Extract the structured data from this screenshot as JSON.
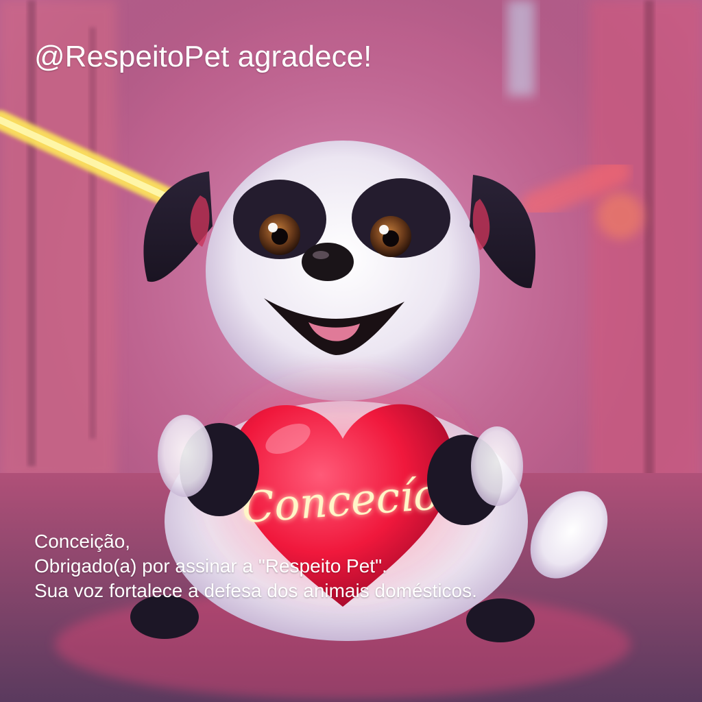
{
  "headline": "@RespeitoPet agradece!",
  "heart_text": "Concecío",
  "message": {
    "line1": "Conceição,",
    "line2": "Obrigado(a) por assinar a \"Respeito Pet\".",
    "line3": "Sua voz fortalece a defesa dos animais domésticos."
  },
  "colors": {
    "heart": "#f0183c",
    "neon_text": "#fff6c8",
    "neon_strip": "#ffe85a",
    "background": "#c0608a"
  }
}
